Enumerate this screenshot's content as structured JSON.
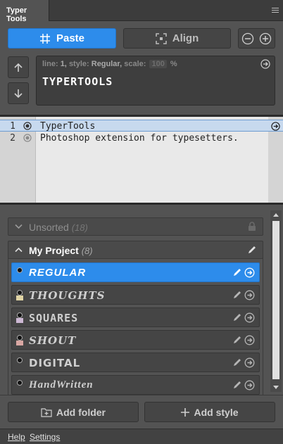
{
  "panel": {
    "tab_title": "Typer Tools"
  },
  "toolbar": {
    "paste_label": "Paste",
    "align_label": "Align"
  },
  "preview": {
    "line_label": "line:",
    "line_value": "1,",
    "style_label": "style:",
    "style_value": "Regular,",
    "scale_label": "scale:",
    "scale_placeholder": "100",
    "scale_unit": "%",
    "sample_text": "TYPERTOOLS"
  },
  "editor": {
    "lines": [
      {
        "number": "1",
        "text": "TyperTools",
        "active": true
      },
      {
        "number": "2",
        "text": "Photoshop extension for typesetters.",
        "active": false
      }
    ]
  },
  "folders": {
    "unsorted": {
      "name": "Unsorted",
      "count": "(18)"
    },
    "project": {
      "name": "My Project",
      "count": "(8)"
    }
  },
  "styles": [
    {
      "name": "REGULAR",
      "color": null,
      "selected": true
    },
    {
      "name": "THOUGHTS",
      "color": "#e0d4a4",
      "selected": false
    },
    {
      "name": "SQUARES",
      "color": "#cdb8d4",
      "selected": false
    },
    {
      "name": "SHOUT",
      "color": "#d9a7a3",
      "selected": false
    },
    {
      "name": "DIGITAL",
      "color": null,
      "selected": false
    },
    {
      "name": "HandWritten",
      "color": null,
      "selected": false
    }
  ],
  "actions": {
    "add_folder_label": "Add folder",
    "add_style_label": "Add style"
  },
  "footer": {
    "help_label": "Help",
    "settings_label": "Settings"
  },
  "colors": {
    "accent": "#2d8ceb",
    "panel_bg": "#535353"
  }
}
